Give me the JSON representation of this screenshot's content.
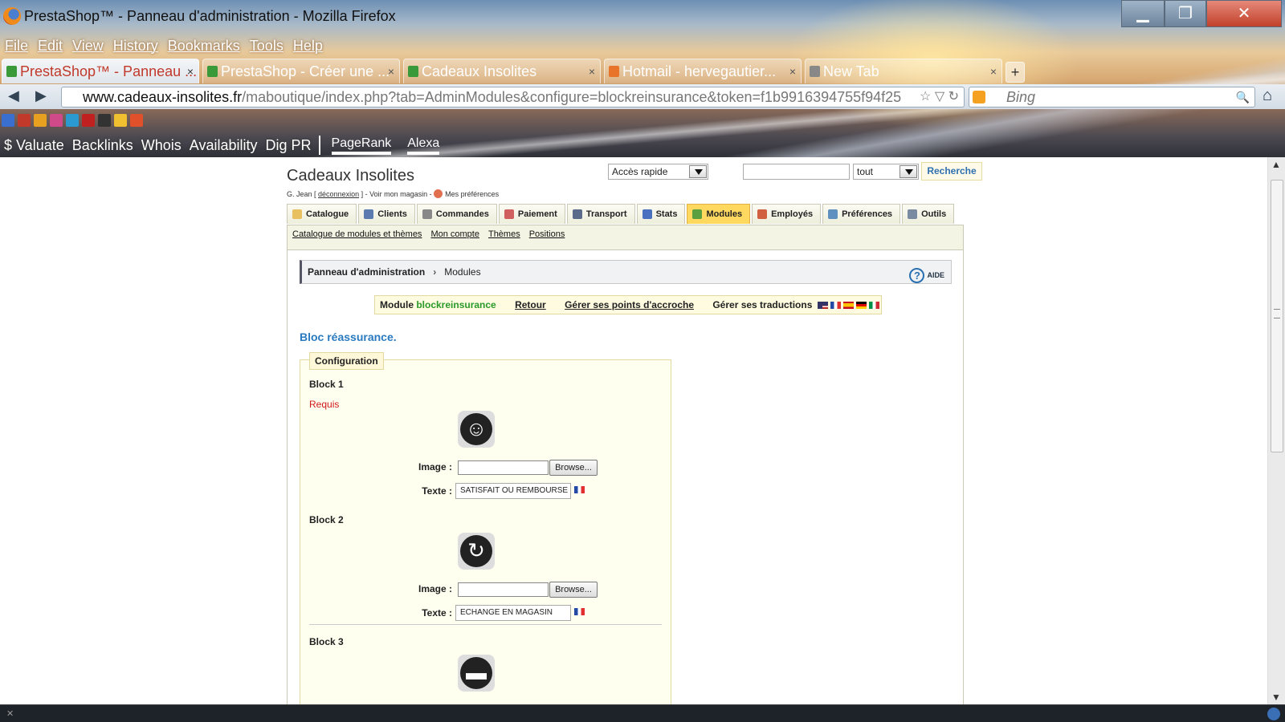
{
  "window": {
    "title": "PrestaShop™ - Panneau d'administration - Mozilla Firefox",
    "min": "▁",
    "max": "❐",
    "close": "✕"
  },
  "menubar": [
    "File",
    "Edit",
    "View",
    "History",
    "Bookmarks",
    "Tools",
    "Help"
  ],
  "browser_tabs": [
    {
      "label": "PrestaShop™ - Panneau ...",
      "color": "#3a9a3a",
      "close": "×"
    },
    {
      "label": "PrestaShop - Créer une ...",
      "color": "#3a9a3a",
      "close": "×"
    },
    {
      "label": "Cadeaux Insolites",
      "color": "#3a9a3a",
      "close": "×"
    },
    {
      "label": "Hotmail - hervegautier...",
      "color": "#e8742a",
      "close": "×"
    },
    {
      "label": "New Tab",
      "color": "#888888",
      "close": "×"
    }
  ],
  "newtab": "+",
  "nav": {
    "back": "◀",
    "forward": "▶",
    "url_domain": "www.cadeaux-insolites.fr",
    "url_path": "/maboutique/index.php?tab=AdminModules&configure=blockreinsurance&token=f1b9916394755f94f25",
    "url_icons": "☆ ▽ ↻",
    "search_placeholder": "Bing",
    "search_icon": "🔍",
    "home": "⌂"
  },
  "bookmark_icons": [
    "#3a6fd0",
    "#c0392b",
    "#e8a020",
    "#d04a8a",
    "#2a9ad0",
    "#c02020",
    "#333333",
    "#f0c030",
    "#e0502a"
  ],
  "seobar": {
    "valuate": "$ Valuate",
    "backlinks": "Backlinks",
    "whois": "Whois",
    "availability": "Availability",
    "digpr": "Dig PR",
    "pagerank": "PageRank",
    "alexa": "Alexa"
  },
  "admin": {
    "shop_title": "Cadeaux Insolites",
    "user": "G. Jean [",
    "logout": "déconnexion",
    "user_rest": "] - Voir mon magasin -",
    "prefs": "Mes préférences",
    "quick_access": "Accès rapide",
    "search_scope": "tout",
    "search_button": "Recherche",
    "tabs": [
      {
        "label": "Catalogue",
        "color": "#e8c060"
      },
      {
        "label": "Clients",
        "color": "#5a7ab0"
      },
      {
        "label": "Commandes",
        "color": "#888888"
      },
      {
        "label": "Paiement",
        "color": "#d06060"
      },
      {
        "label": "Transport",
        "color": "#5a6a8a"
      },
      {
        "label": "Stats",
        "color": "#4a70c0"
      },
      {
        "label": "Modules",
        "color": "#5aa040"
      },
      {
        "label": "Employés",
        "color": "#d06040"
      },
      {
        "label": "Préférences",
        "color": "#6090c0"
      },
      {
        "label": "Outils",
        "color": "#7a8aa0"
      }
    ],
    "active_tab": "Modules",
    "subtabs": [
      "Catalogue de modules et thèmes",
      "Mon compte",
      "Thèmes",
      "Positions"
    ],
    "breadcrumb": {
      "root": "Panneau d'administration",
      "sep": "›",
      "current": "Modules",
      "help": "AIDE",
      "help_icon": "?"
    },
    "modbar": {
      "prefix": "Module",
      "module": "blockreinsurance",
      "back": "Retour",
      "hooks": "Gérer ses points d'accroche",
      "translations": "Gérer ses traductions"
    },
    "section_title": "Bloc réassurance.",
    "legend": "Configuration",
    "required": "Requis",
    "image_label": "Image :",
    "text_label": "Texte :",
    "browse": "Browse...",
    "blocks": [
      {
        "title": "Block 1",
        "icon": "☺",
        "text": "SATISFAIT OU REMBOURSE"
      },
      {
        "title": "Block 2",
        "icon": "↻",
        "text": "ECHANGE EN MAGASIN"
      },
      {
        "title": "Block 3",
        "icon": "▬"
      }
    ]
  },
  "scrollbar": {
    "up": "▲",
    "down": "▼"
  }
}
